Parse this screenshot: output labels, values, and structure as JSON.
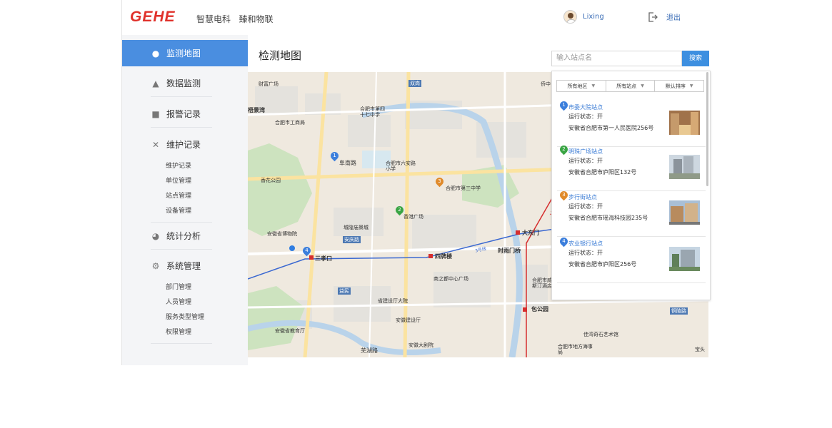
{
  "header": {
    "logo": "GEHE",
    "slogan": "智慧电科   臻和物联",
    "username": "Lixing",
    "logout_label": "退出"
  },
  "sidebar": {
    "items": [
      {
        "label": "监测地图",
        "icon": "map-pin-icon",
        "active": true
      },
      {
        "label": "数据监测",
        "icon": "chart-icon"
      },
      {
        "label": "报警记录",
        "icon": "alarm-icon"
      },
      {
        "label": "维护记录",
        "icon": "tools-icon",
        "children": [
          "维护记录",
          "单位管理",
          "站点管理",
          "设备管理"
        ]
      },
      {
        "label": "统计分析",
        "icon": "pie-chart-icon"
      },
      {
        "label": "系统管理",
        "icon": "gear-icon",
        "children": [
          "部门管理",
          "人员管理",
          "服务类型管理",
          "权限管理"
        ]
      }
    ]
  },
  "main": {
    "title": "检测地图",
    "search_placeholder": "输入站点名",
    "search_button": "搜索",
    "filters": [
      "所有地区",
      "所有站点",
      "默认排序"
    ],
    "stations": [
      {
        "num": "1",
        "name": "市委大院站点",
        "status": "运行状态：开",
        "address": "安徽省合肥市第一人民医院256号",
        "color": "#3c7fdc"
      },
      {
        "num": "2",
        "name": "明珠广场站点",
        "status": "运行状态：开",
        "address": "安徽省合肥市庐阳区132号",
        "color": "#3aa544"
      },
      {
        "num": "3",
        "name": "步行街站点",
        "status": "运行状态：开",
        "address": "安徽省合肥市瑶海科技园235号",
        "color": "#e08a2a"
      },
      {
        "num": "4",
        "name": "农业银行站点",
        "status": "运行状态：开",
        "address": "安徽省合肥市庐阳区256号",
        "color": "#3c7fdc"
      }
    ]
  },
  "map": {
    "labels": [
      "财富广场",
      "双岗",
      "合肥市第四十七中学",
      "梧景湾",
      "合肥市工商局",
      "阜南路",
      "合肥市六安路小学",
      "香花公园",
      "合肥市第三中学",
      "香港广场",
      "城隍庙景城",
      "安徽省博物院",
      "安庆路",
      "三孝口",
      "四牌楼",
      "大东门",
      "时雨门桥",
      "商之都中心广场",
      "益民",
      "省建设厅大院",
      "安徽建设厅",
      "安徽省教育厅",
      "芜湖路",
      "安徽大剧院",
      "包公园",
      "合肥市威斯汀酒店",
      "佳湾奇石艺术馆",
      "合肥市地方海事局",
      "铜陵路",
      "宝头",
      "侨中",
      "3号线",
      "1号线"
    ],
    "pins": [
      "1",
      "2",
      "3",
      "4"
    ]
  }
}
